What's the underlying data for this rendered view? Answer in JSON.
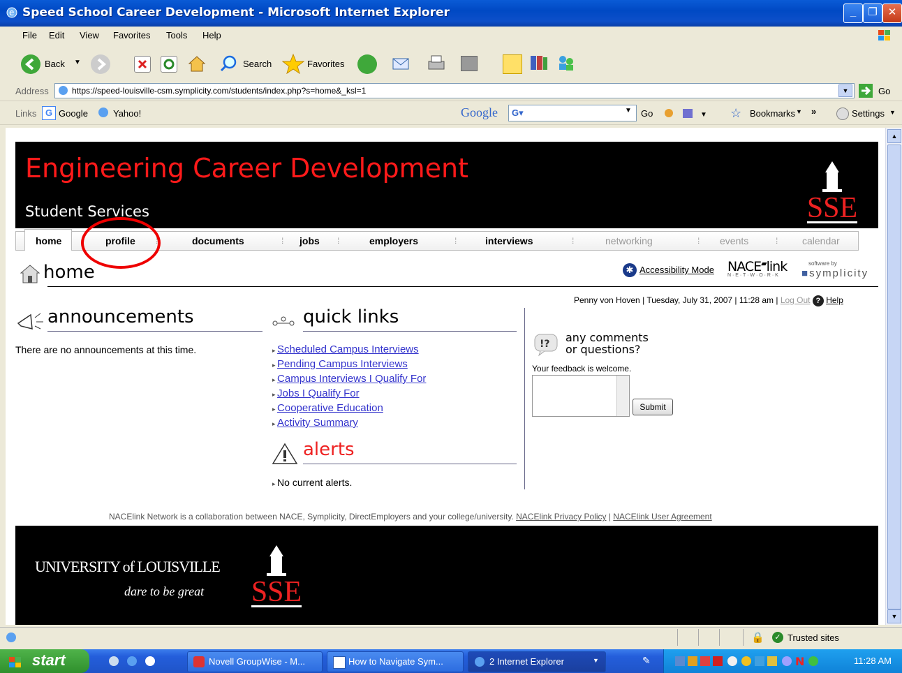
{
  "window": {
    "title": "Speed School Career Development - Microsoft Internet Explorer",
    "controls": [
      "minimize-icon",
      "maximize-icon",
      "close-icon"
    ]
  },
  "menu": [
    "File",
    "Edit",
    "View",
    "Favorites",
    "Tools",
    "Help"
  ],
  "toolbar": {
    "back": "Back",
    "search": "Search",
    "favorites": "Favorites"
  },
  "address": {
    "label": "Address",
    "url": "https://speed-louisville-csm.symplicity.com/students/index.php?s=home&_ksl=1",
    "go": "Go"
  },
  "links_bar": {
    "label": "Links",
    "items": [
      "Google",
      "Yahoo!"
    ],
    "google_toolbar": {
      "brand": "Google",
      "go": "Go",
      "bookmarks": "Bookmarks",
      "more": "»",
      "settings": "Settings"
    }
  },
  "page": {
    "header": {
      "title": "Engineering Career Development",
      "subtitle": "Student Services",
      "logo_text": "SSE"
    },
    "nav": [
      "home",
      "profile",
      "documents",
      "jobs",
      "employers",
      "interviews",
      "networking",
      "events",
      "calendar"
    ],
    "page_title": "home",
    "accessibility": "Accessibility Mode",
    "nace_logo": "NACE",
    "nace_logo_link": "link",
    "nace_network": "N · E · T · W · O · R · K",
    "software_by": "software by",
    "symplicity": "symplicity",
    "userline": {
      "name": "Penny von Hoven",
      "date": "Tuesday, July 31, 2007",
      "time": "11:28 am",
      "logout": "Log Out",
      "help": "Help"
    },
    "announcements": {
      "title": "announcements",
      "text": "There are no announcements at this time."
    },
    "quick_links": {
      "title": "quick links",
      "items": [
        "Scheduled Campus Interviews",
        "Pending Campus Interviews",
        "Campus Interviews I Qualify For",
        "Jobs I Qualify For",
        "Cooperative Education",
        "Activity Summary"
      ]
    },
    "alerts": {
      "title": "alerts",
      "text": "No current alerts."
    },
    "comments": {
      "title_line1": "any comments",
      "title_line2": "or questions?",
      "prompt": "Your feedback is welcome.",
      "submit": "Submit"
    },
    "footer_note": "NACElink Network is a collaboration between NACE, Symplicity, DirectEmployers and your college/university.",
    "footer_links": [
      "NACElink Privacy Policy",
      "NACElink User Agreement"
    ],
    "footer": {
      "university": "UNIVERSITY of LOUISVILLE",
      "tagline": "dare to be great",
      "logo_text": "SSE"
    }
  },
  "statusbar": {
    "zone": "Trusted sites"
  },
  "taskbar": {
    "start": "start",
    "tasks": [
      "Novell GroupWise - M...",
      "How to Navigate Sym...",
      "2 Internet Explorer"
    ],
    "clock": "11:28 AM"
  }
}
